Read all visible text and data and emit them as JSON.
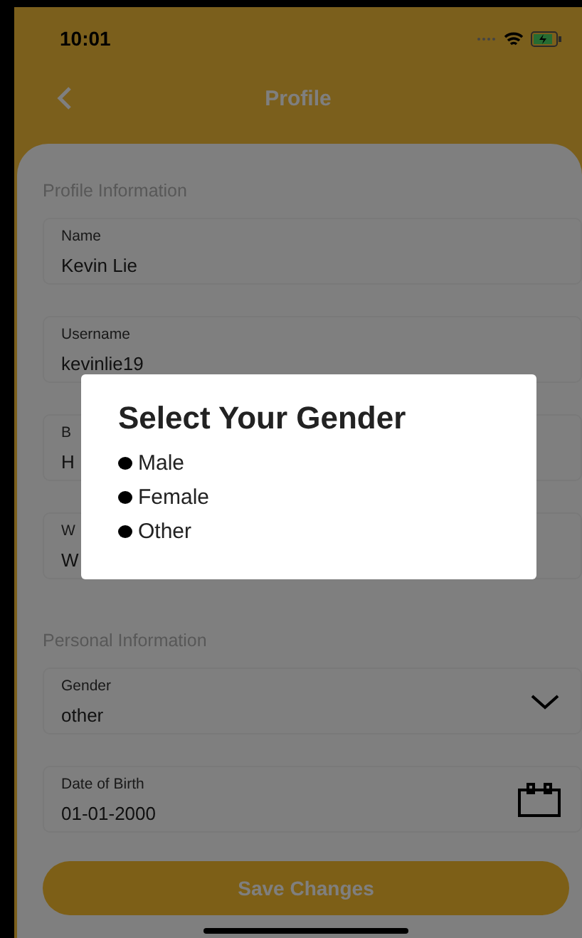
{
  "status_bar": {
    "time": "10:01"
  },
  "header": {
    "title": "Profile"
  },
  "sections": [
    {
      "title": "Profile Information",
      "fields": [
        {
          "kind": "text",
          "label": "Name",
          "value": "Kevin Lie"
        },
        {
          "kind": "text",
          "label": "Username",
          "value": "kevinlie19"
        },
        {
          "kind": "text",
          "label": "B",
          "value": "H"
        },
        {
          "kind": "text",
          "label": "W",
          "value": "W"
        }
      ]
    },
    {
      "title": "Personal Information",
      "fields": [
        {
          "kind": "dropdown",
          "label": "Gender",
          "value": "other"
        },
        {
          "kind": "date",
          "label": "Date of Birth",
          "value": "01-01-2000"
        }
      ]
    }
  ],
  "save_button": {
    "label": "Save Changes"
  },
  "dialog": {
    "title": "Select Your Gender",
    "options": [
      {
        "label": "Male"
      },
      {
        "label": "Female"
      },
      {
        "label": "Other"
      }
    ]
  }
}
